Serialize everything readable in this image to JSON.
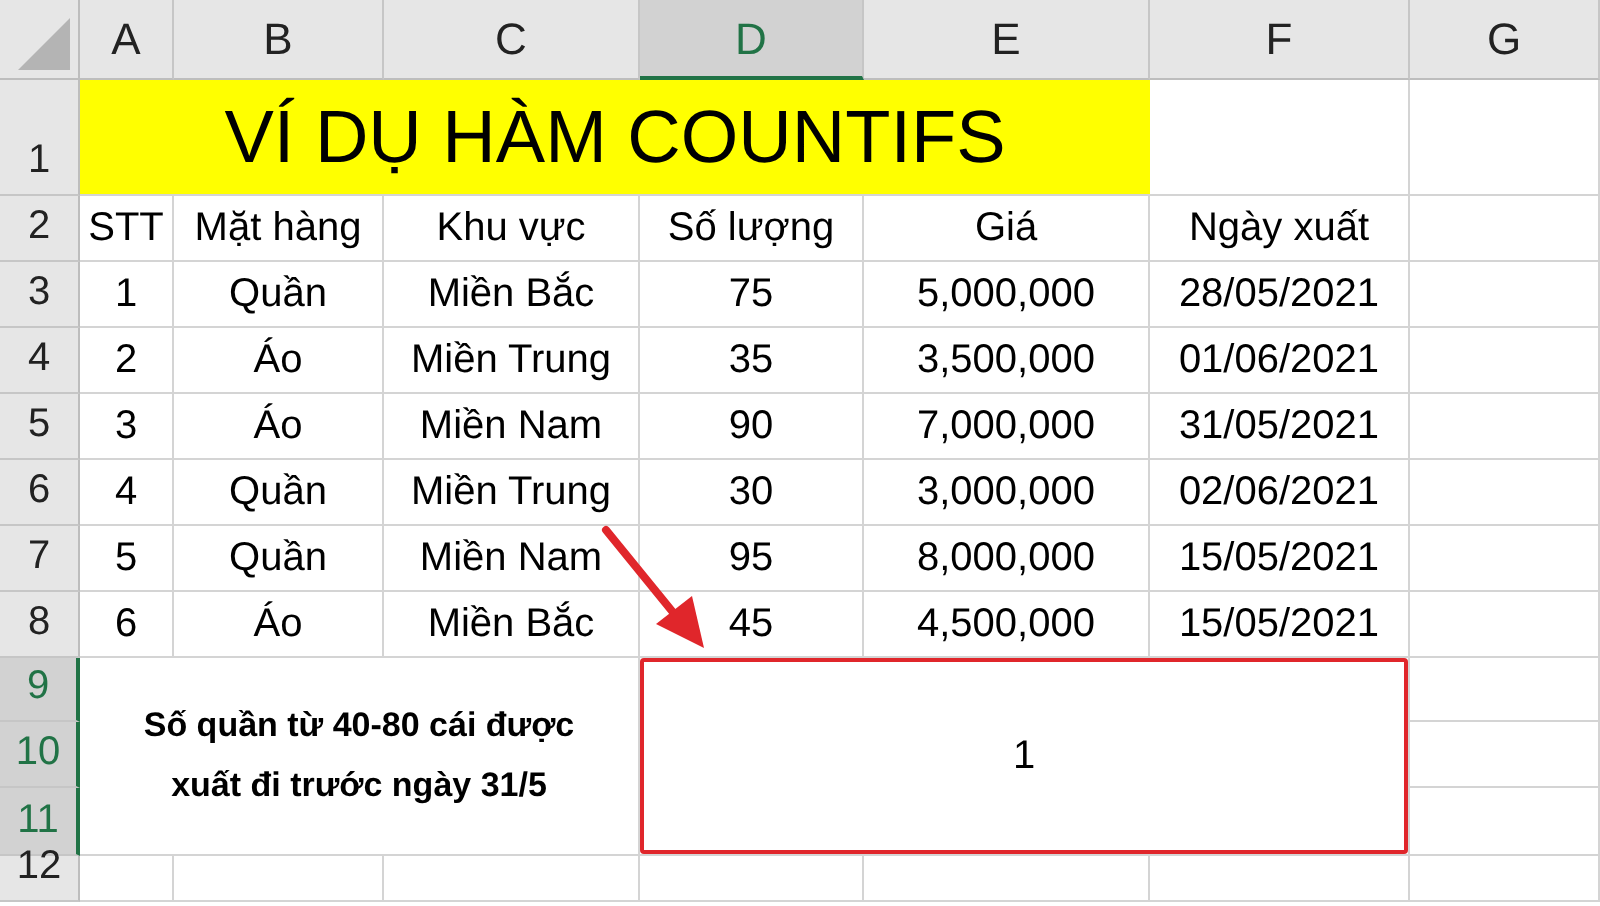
{
  "columns": [
    {
      "label": "A",
      "selected": false
    },
    {
      "label": "B",
      "selected": false
    },
    {
      "label": "C",
      "selected": false
    },
    {
      "label": "D",
      "selected": true
    },
    {
      "label": "E",
      "selected": false
    },
    {
      "label": "F",
      "selected": false
    },
    {
      "label": "G",
      "selected": false
    }
  ],
  "rows": [
    {
      "label": "1",
      "selected": false
    },
    {
      "label": "2",
      "selected": false
    },
    {
      "label": "3",
      "selected": false
    },
    {
      "label": "4",
      "selected": false
    },
    {
      "label": "5",
      "selected": false
    },
    {
      "label": "6",
      "selected": false
    },
    {
      "label": "7",
      "selected": false
    },
    {
      "label": "8",
      "selected": false
    },
    {
      "label": "9",
      "selected": true
    },
    {
      "label": "10",
      "selected": true
    },
    {
      "label": "11",
      "selected": true
    },
    {
      "label": "12",
      "selected": false
    }
  ],
  "title": "VÍ DỤ HÀM COUNTIFS",
  "table": {
    "columns": [
      "STT",
      "Mặt hàng",
      "Khu vực",
      "Số lượng",
      "Giá",
      "Ngày xuất"
    ],
    "rows": [
      [
        "1",
        "Quần",
        "Miền Bắc",
        "75",
        "5,000,000",
        "28/05/2021"
      ],
      [
        "2",
        "Áo",
        "Miền Trung",
        "35",
        "3,500,000",
        "01/06/2021"
      ],
      [
        "3",
        "Áo",
        "Miền Nam",
        "90",
        "7,000,000",
        "31/05/2021"
      ],
      [
        "4",
        "Quần",
        "Miền Trung",
        "30",
        "3,000,000",
        "02/06/2021"
      ],
      [
        "5",
        "Quần",
        "Miền Nam",
        "95",
        "8,000,000",
        "15/05/2021"
      ],
      [
        "6",
        "Áo",
        "Miền Bắc",
        "45",
        "4,500,000",
        "15/05/2021"
      ]
    ]
  },
  "summary": {
    "label": "Số quần từ 40-80 cái được xuất đi trước ngày 31/5",
    "result": "1"
  }
}
